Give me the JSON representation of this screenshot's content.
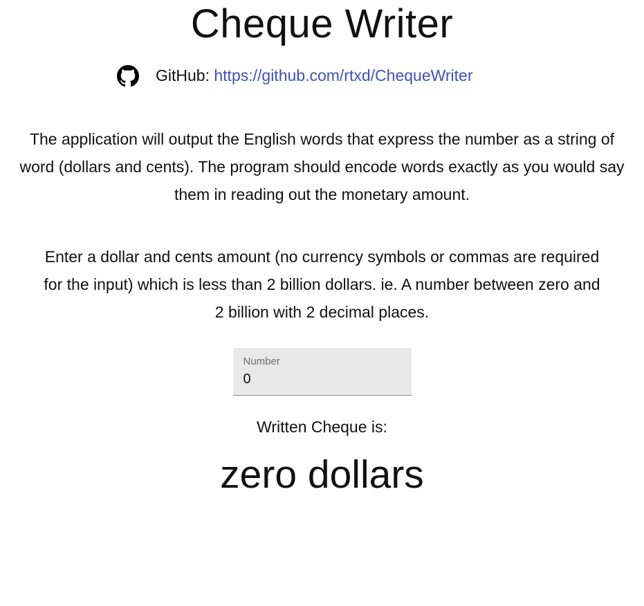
{
  "header": {
    "title": "Cheque Writer"
  },
  "github": {
    "label": "GitHub:",
    "link_text": "https://github.com/rtxd/ChequeWriter",
    "icon": "github-icon"
  },
  "description": {
    "paragraph_1": "The application will output the English words that express the number as a string of word (dollars and cents). The program should encode words exactly as you would say them in reading out the monetary amount.",
    "paragraph_2": "Enter a dollar and cents amount (no currency symbols or commas are required for the input) which is less than 2 billion dollars. ie. A number between zero and 2 billion with 2 decimal places."
  },
  "number_field": {
    "label": "Number",
    "value": "0"
  },
  "output": {
    "label": "Written Cheque is:",
    "result": "zero dollars"
  },
  "colors": {
    "link": "#3f51b5",
    "field_background": "#e8e8e8",
    "text": "#111111"
  }
}
